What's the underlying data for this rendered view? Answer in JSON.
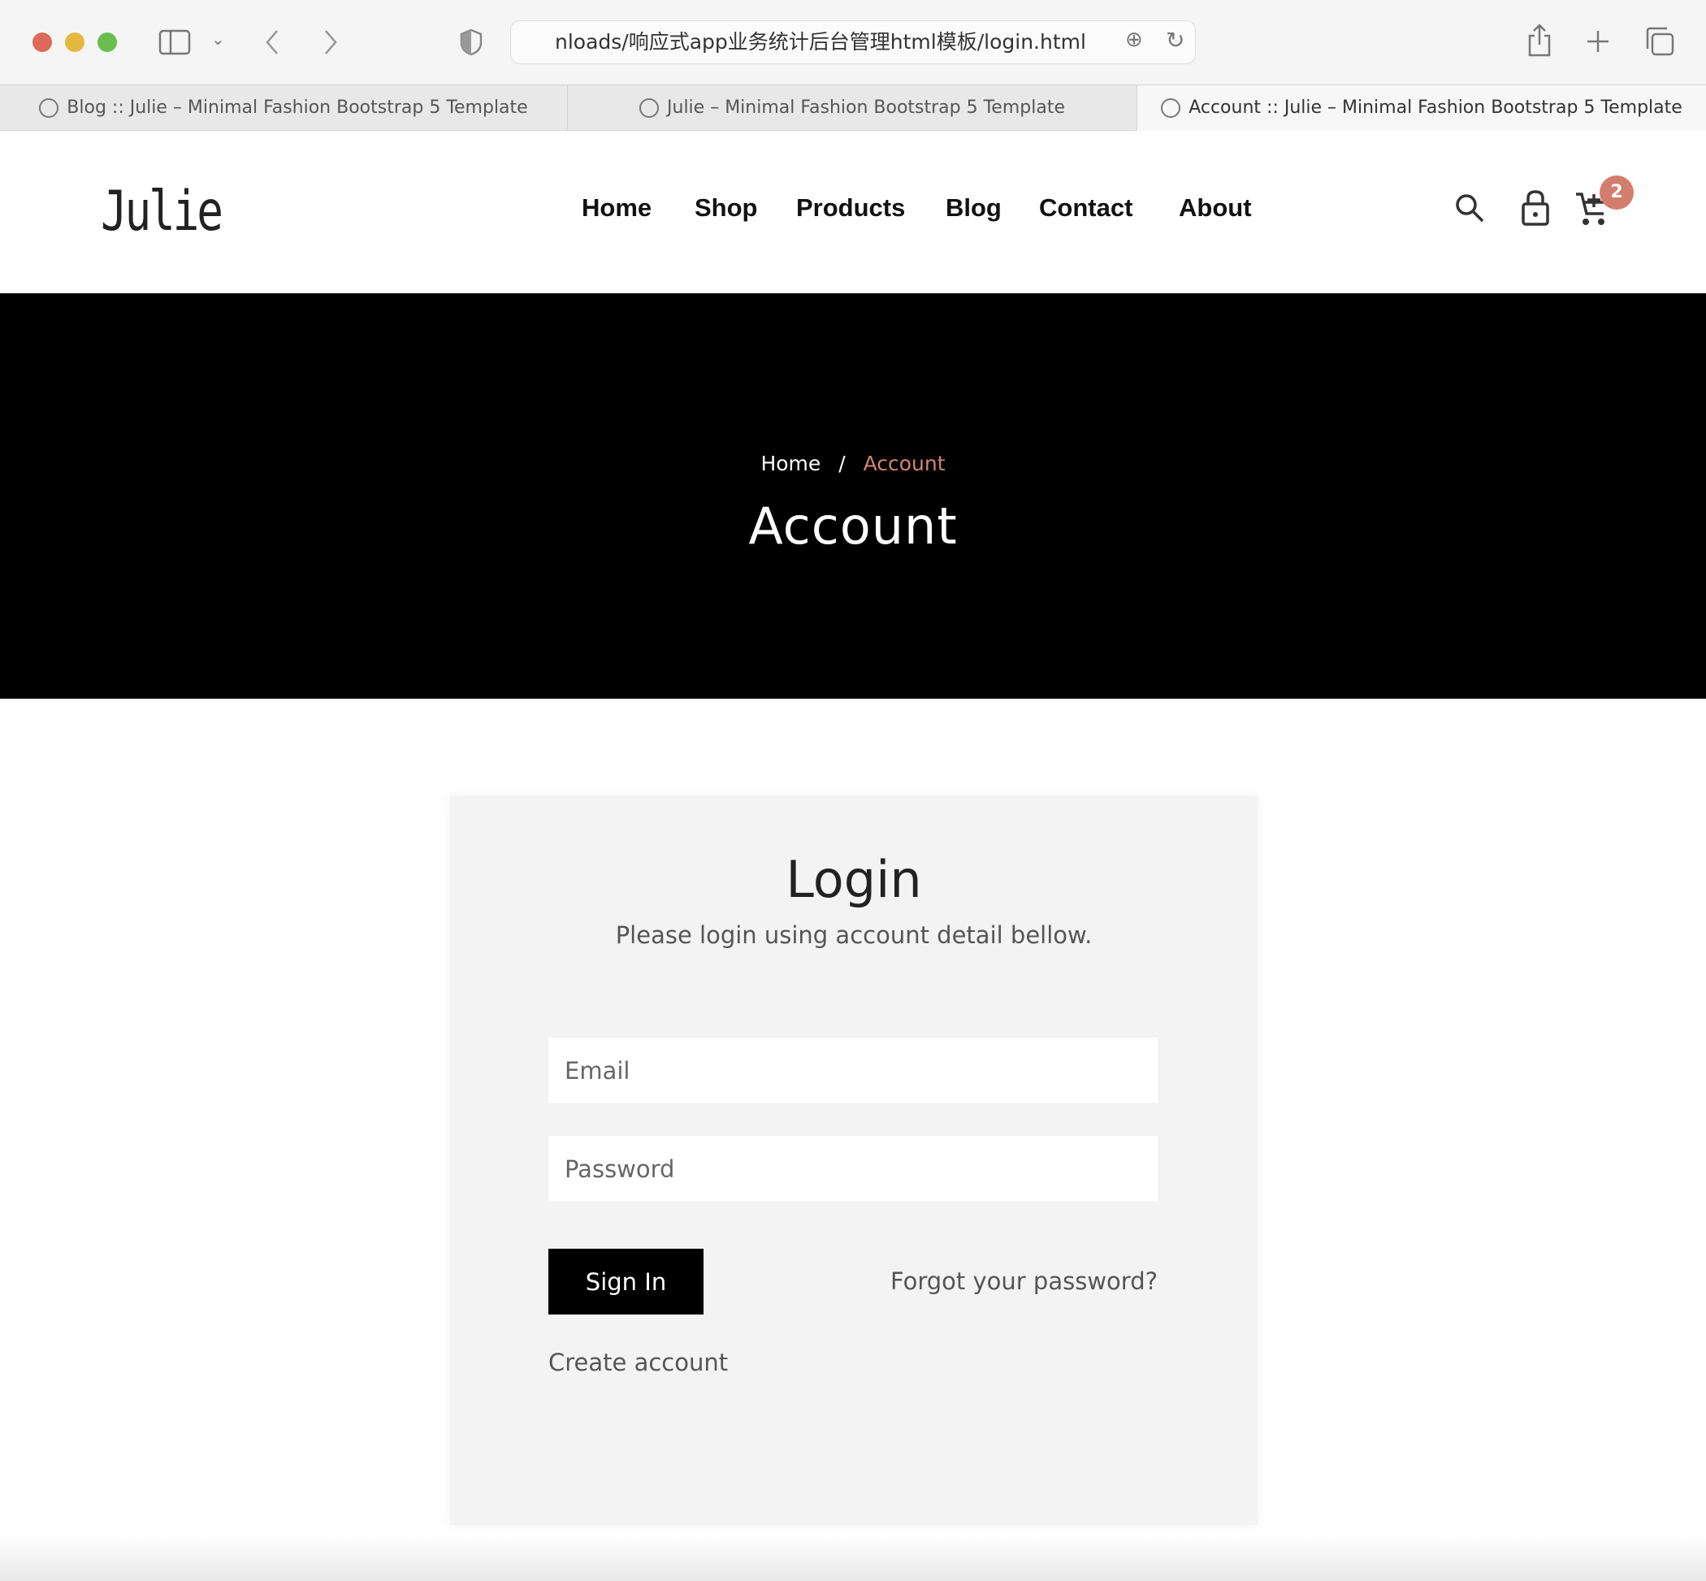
{
  "browser": {
    "url": "nloads/响应式app业务统计后台管理html模板/login.html",
    "tabs": [
      {
        "label": "Blog :: Julie – Minimal Fashion Bootstrap 5 Template",
        "active": false
      },
      {
        "label": "Julie – Minimal Fashion Bootstrap 5 Template",
        "active": false
      },
      {
        "label": "Account :: Julie – Minimal Fashion Bootstrap 5 Template",
        "active": true
      }
    ]
  },
  "header": {
    "logo": "Julie",
    "nav": [
      "Home",
      "Shop",
      "Products",
      "Blog",
      "Contact",
      "About"
    ],
    "cart_count": "2",
    "badge_color": "#d37d6f"
  },
  "hero": {
    "breadcrumb": {
      "home": "Home",
      "separator": "/",
      "current": "Account"
    },
    "title": "Account",
    "accent_color": "#d38470"
  },
  "login": {
    "title": "Login",
    "subtitle": "Please login using account detail bellow.",
    "email_placeholder": "Email",
    "password_placeholder": "Password",
    "sign_in": "Sign In",
    "forgot": "Forgot your password?",
    "create": "Create account"
  }
}
